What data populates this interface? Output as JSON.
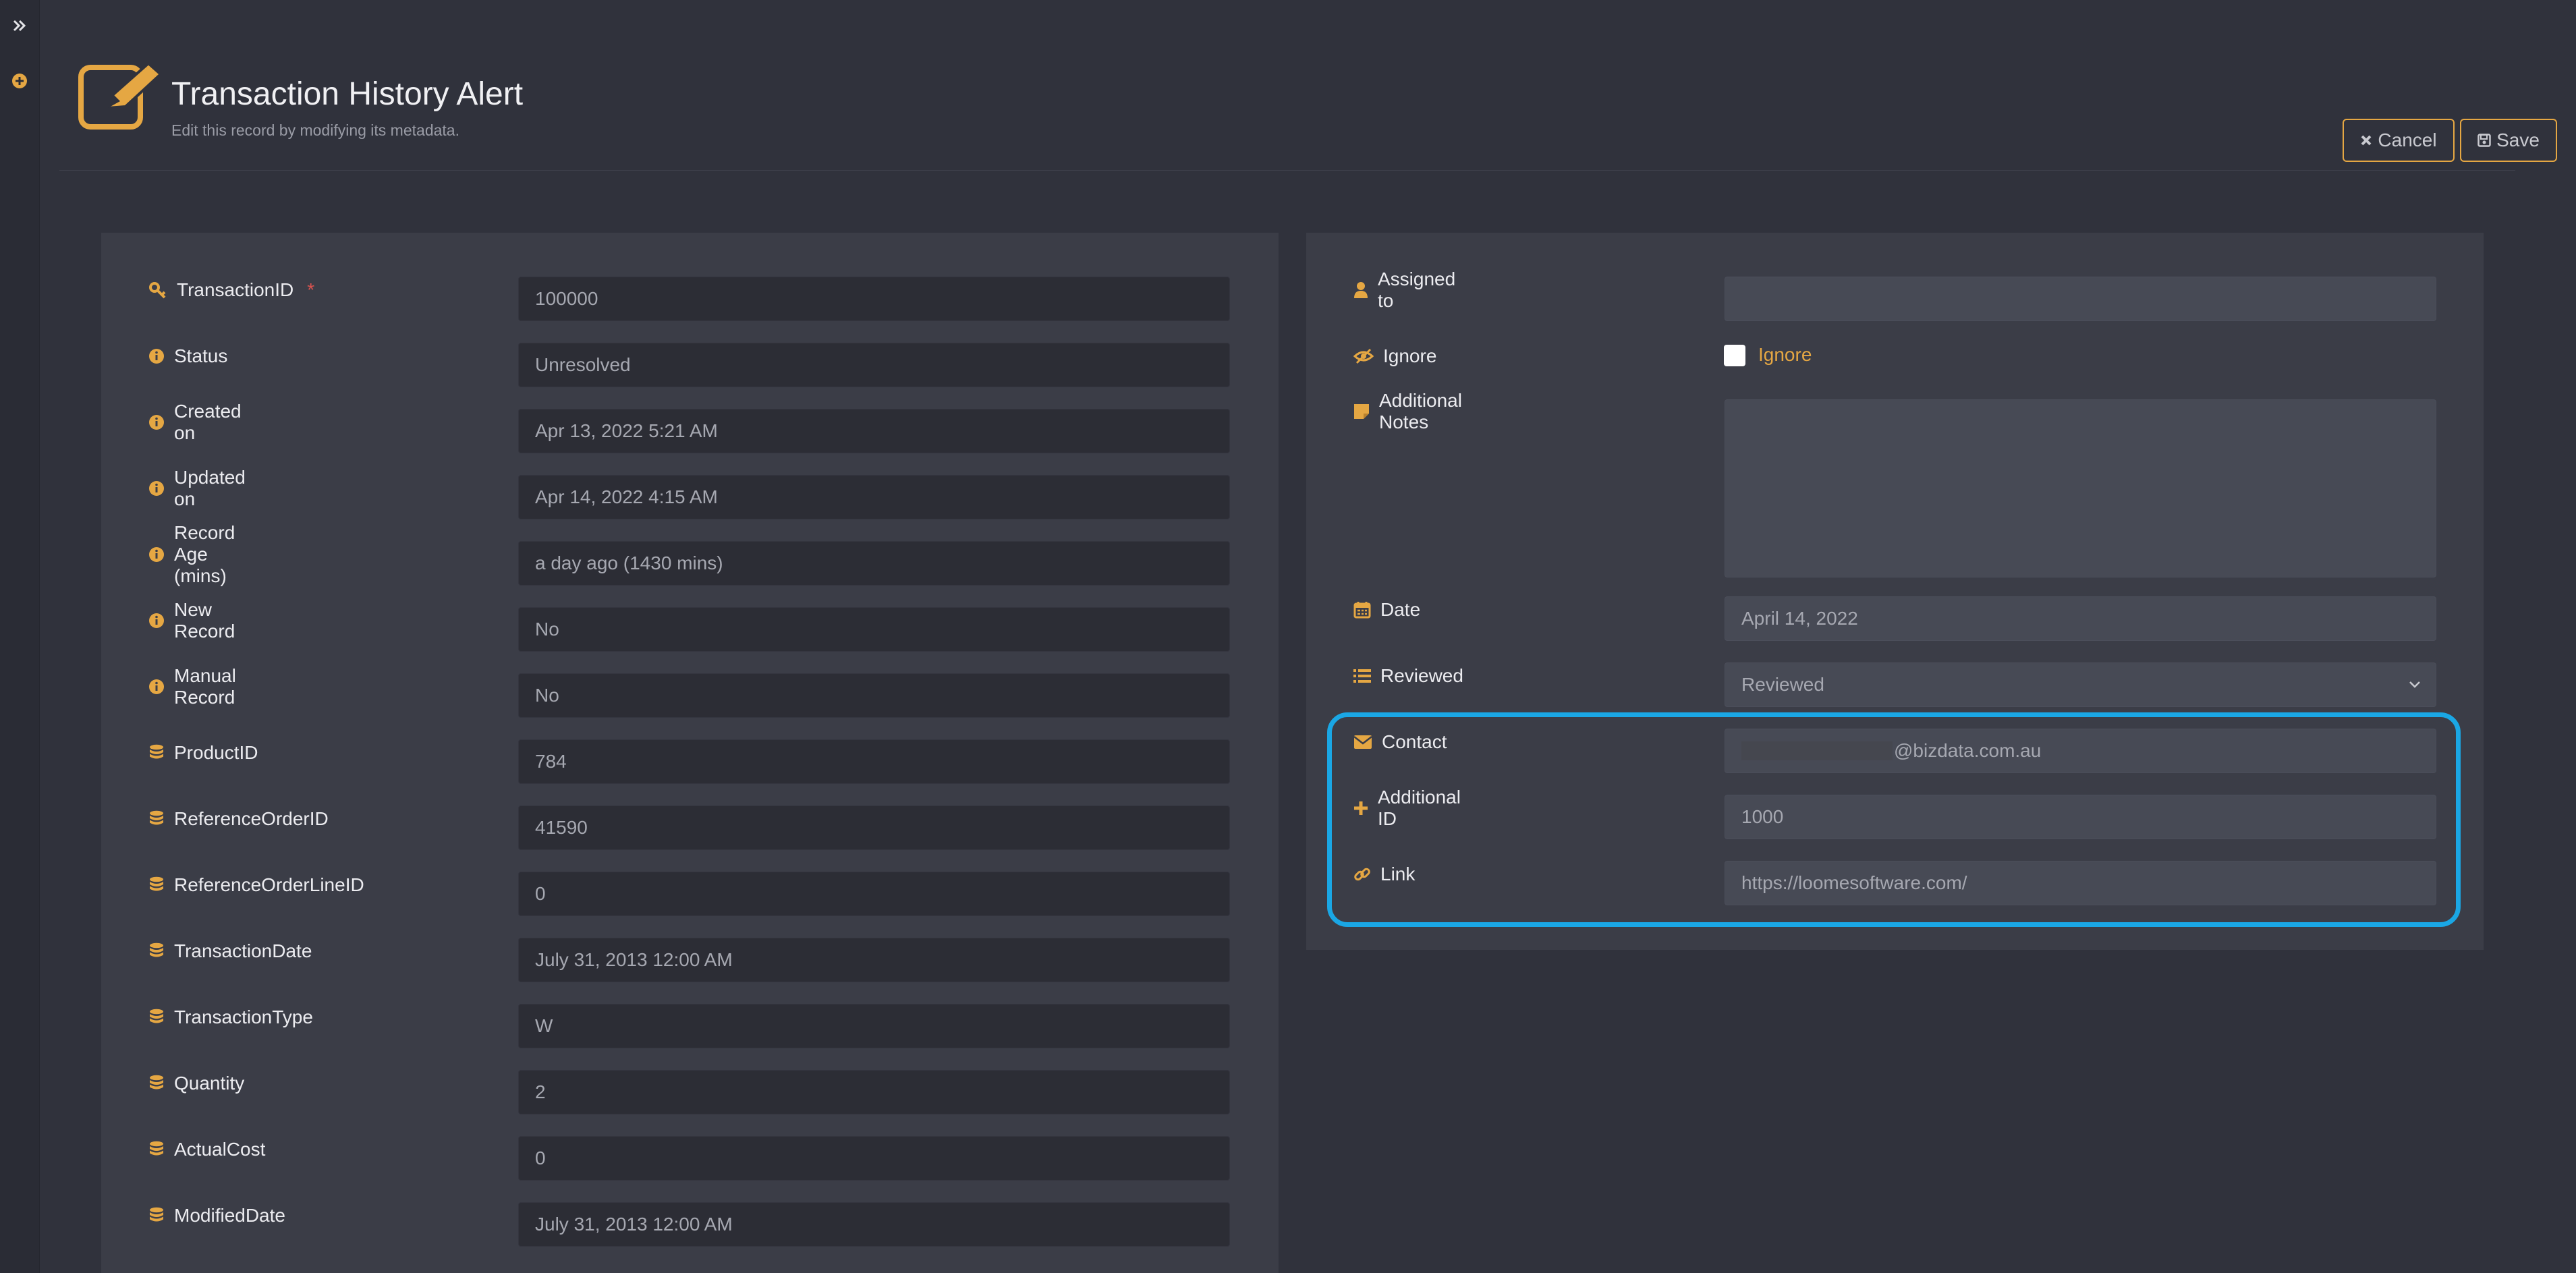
{
  "header": {
    "title": "Transaction History Alert",
    "subtitle": "Edit this record by modifying its metadata.",
    "cancel_label": "Cancel",
    "save_label": "Save"
  },
  "left_fields": [
    {
      "label": "TransactionID",
      "value": "100000",
      "icon": "key-icon",
      "required_mark": "*"
    },
    {
      "label": "Status",
      "value": "Unresolved",
      "icon": "info-icon"
    },
    {
      "label": "Created on",
      "value": "Apr 13, 2022 5:21 AM",
      "icon": "info-icon"
    },
    {
      "label": "Updated on",
      "value": "Apr 14, 2022 4:15 AM",
      "icon": "info-icon"
    },
    {
      "label": "Record Age (mins)",
      "value": "a day ago (1430 mins)",
      "icon": "info-icon"
    },
    {
      "label": "New Record",
      "value": "No",
      "icon": "info-icon"
    },
    {
      "label": "Manual Record",
      "value": "No",
      "icon": "info-icon"
    },
    {
      "label": "ProductID",
      "value": "784",
      "icon": "database-icon"
    },
    {
      "label": "ReferenceOrderID",
      "value": "41590",
      "icon": "database-icon"
    },
    {
      "label": "ReferenceOrderLineID",
      "value": "0",
      "icon": "database-icon"
    },
    {
      "label": "TransactionDate",
      "value": "July 31, 2013 12:00 AM",
      "icon": "database-icon"
    },
    {
      "label": "TransactionType",
      "value": "W",
      "icon": "database-icon"
    },
    {
      "label": "Quantity",
      "value": "2",
      "icon": "database-icon"
    },
    {
      "label": "ActualCost",
      "value": "0",
      "icon": "database-icon"
    },
    {
      "label": "ModifiedDate",
      "value": "July 31, 2013 12:00 AM",
      "icon": "database-icon"
    }
  ],
  "right_fields": {
    "assigned_to": {
      "label": "Assigned to",
      "value": "",
      "icon": "user-icon"
    },
    "ignore": {
      "label": "Ignore",
      "checkbox_label": "Ignore",
      "checked": false,
      "icon": "eye-slash-icon"
    },
    "notes": {
      "label": "Additional Notes",
      "value": "",
      "icon": "sticky-note-icon"
    },
    "date": {
      "label": "Date",
      "value": "April 14, 2022",
      "icon": "calendar-icon"
    },
    "reviewed": {
      "label": "Reviewed",
      "value": "Reviewed",
      "icon": "list-icon"
    },
    "contact": {
      "label": "Contact",
      "value": "@bizdata.com.au",
      "icon": "envelope-icon"
    },
    "additional_id": {
      "label": "Additional ID",
      "value": "1000",
      "icon": "plus-icon"
    },
    "link": {
      "label": "Link",
      "value": "https://loomesoftware.com/",
      "icon": "link-icon"
    }
  },
  "colors": {
    "accent": "#e5a743",
    "highlight": "#1aa7e5",
    "background": "#30323c",
    "panel": "#3b3d47"
  }
}
